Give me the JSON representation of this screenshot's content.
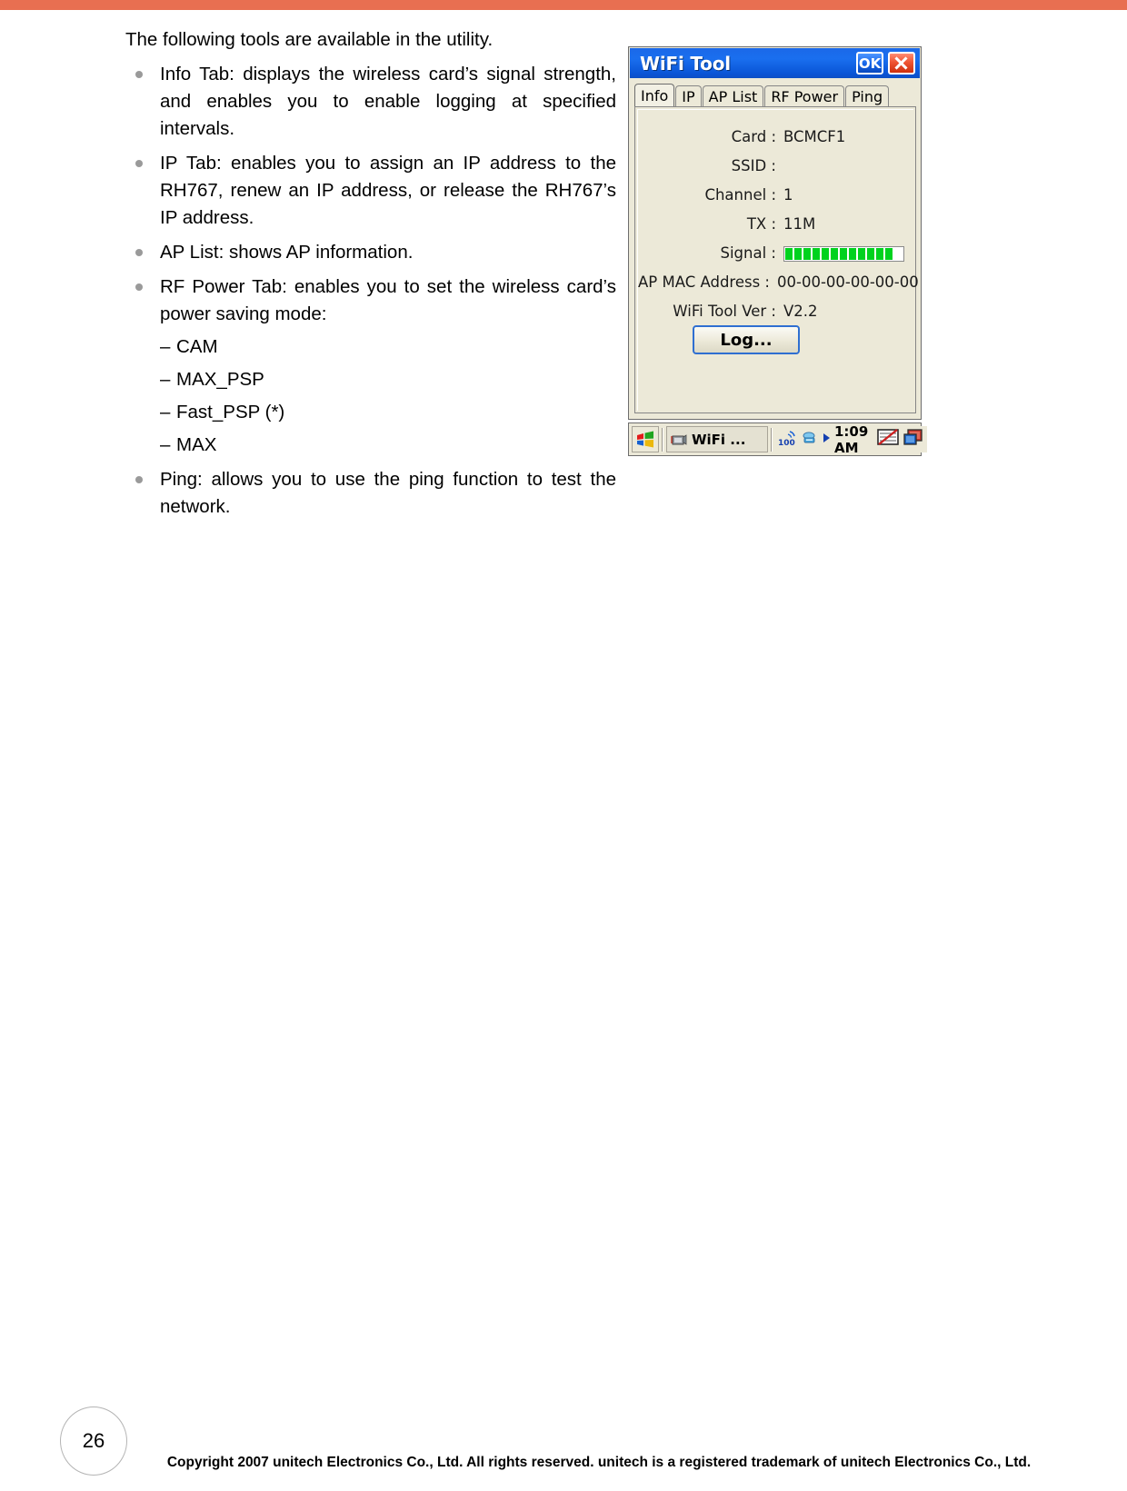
{
  "page": {
    "accent_color": "#e86f51",
    "number": "26",
    "copyright": "Copyright 2007 unitech Electronics Co., Ltd. All rights reserved. unitech is a registered trademark of unitech Electronics Co., Ltd."
  },
  "content": {
    "intro": "The following tools are available in the utility.",
    "bullets": [
      {
        "text": "Info Tab: displays the wireless card’s signal strength, and enables you to enable logging at specified intervals."
      },
      {
        "text": "IP Tab: enables you to assign an IP address to the RH767, renew an IP address, or release the RH767’s IP address."
      },
      {
        "text": "AP List: shows AP information."
      },
      {
        "text": "RF Power Tab: enables you to set the wireless card’s power saving mode:"
      },
      {
        "text": "Ping: allows you to use the ping function to test the network."
      }
    ],
    "sub_items": [
      {
        "dash": "–",
        "label": "CAM"
      },
      {
        "dash": "–",
        "label": "MAX_PSP"
      },
      {
        "dash": "–",
        "label": "Fast_PSP (*)"
      },
      {
        "dash": "–",
        "label": "MAX"
      }
    ]
  },
  "dialog": {
    "title": "WiFi Tool",
    "titlebar_color": "#1464e8",
    "buttons": {
      "ok_label": "OK",
      "close_label": ""
    },
    "tabs": [
      {
        "label": "Info",
        "active": true
      },
      {
        "label": "IP",
        "active": false
      },
      {
        "label": "AP List",
        "active": false
      },
      {
        "label": "RF Power",
        "active": false
      },
      {
        "label": "Ping",
        "active": false
      }
    ],
    "fields": [
      {
        "label": "Card :",
        "value": "BCMCF1"
      },
      {
        "label": "SSID :",
        "value": ""
      },
      {
        "label": "Channel :",
        "value": "1"
      },
      {
        "label": "TX :",
        "value": "11M"
      },
      {
        "label": "Signal :",
        "value": "",
        "type": "signal-bar",
        "segments": 12,
        "segment_color": "#00d21e"
      },
      {
        "label": "AP MAC Address :",
        "value": "00-00-00-00-00-00"
      },
      {
        "label": "WiFi Tool Ver :",
        "value": "V2.2"
      }
    ],
    "log_button_label": "Log...",
    "taskbar": {
      "start_icon": "windows-start-icon",
      "task_label": "WiFi ...",
      "task_icon": "wifi-tool-icon",
      "battery_label": "100",
      "network_icon": "network-connection-icon",
      "play_icon": "play-arrow-icon",
      "clock": "1:09 AM",
      "keyboard_icon": "keyboard-disabled-icon",
      "desktop_icon": "show-desktop-icon"
    }
  }
}
